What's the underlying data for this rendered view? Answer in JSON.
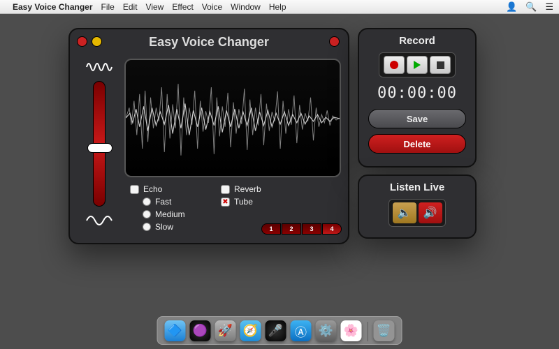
{
  "menubar": {
    "app_name": "Easy Voice Changer",
    "items": [
      "File",
      "Edit",
      "View",
      "Effect",
      "Voice",
      "Window",
      "Help"
    ]
  },
  "main": {
    "title": "Easy Voice Changer",
    "effects": {
      "echo": "Echo",
      "fast": "Fast",
      "medium": "Medium",
      "slow": "Slow",
      "reverb": "Reverb",
      "tube": "Tube"
    },
    "presets": [
      "1",
      "2",
      "3",
      "4"
    ]
  },
  "record": {
    "title": "Record",
    "timer": "00:00:00",
    "save_label": "Save",
    "delete_label": "Delete"
  },
  "listen": {
    "title": "Listen Live"
  },
  "dock": {
    "finder": "🔷",
    "siri": "🟣",
    "launchpad": "🚀",
    "safari": "🧭",
    "app": "🎤",
    "appstore": "Ⓐ",
    "settings": "⚙️",
    "photos": "🌸",
    "trash": "🗑️"
  }
}
